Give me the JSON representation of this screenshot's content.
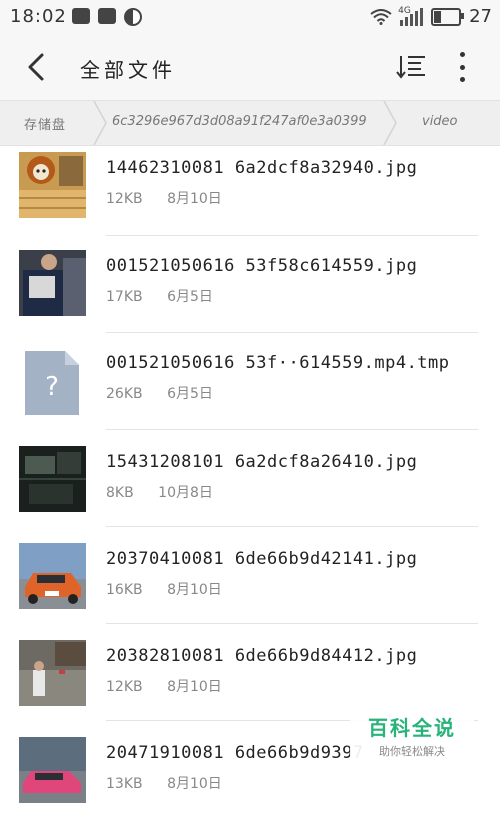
{
  "status_bar": {
    "time": "18:02",
    "network_label": "4G",
    "battery_text": "27",
    "battery_level": 0.27,
    "icons": [
      "image-icon",
      "chat-bubble-icon",
      "half-circle-icon",
      "wifi-icon",
      "signal-icon",
      "battery-icon"
    ]
  },
  "header": {
    "title": "全部文件"
  },
  "breadcrumb": {
    "items": [
      "存储盘",
      "6c3296e967d3d08a91f247af0e3a0399",
      "video"
    ]
  },
  "files": [
    {
      "name": "14462310081 6a2dcf8a32940.jpg",
      "size": "12KB",
      "date": "8月10日",
      "thumb": "cat-plush"
    },
    {
      "name": "001521050616 53f58c614559.jpg",
      "size": "17KB",
      "date": "6月5日",
      "thumb": "person-box"
    },
    {
      "name": "001521050616 53f··614559.mp4.tmp",
      "size": "26KB",
      "date": "6月5日",
      "thumb": "unknown-file"
    },
    {
      "name": "15431208101 6a2dcf8a26410.jpg",
      "size": "8KB",
      "date": "10月8日",
      "thumb": "dark-room"
    },
    {
      "name": "20370410081 6de66b9d42141.jpg",
      "size": "16KB",
      "date": "8月10日",
      "thumb": "orange-car"
    },
    {
      "name": "20382810081 6de66b9d84412.jpg",
      "size": "12KB",
      "date": "8月10日",
      "thumb": "game-scene"
    },
    {
      "name": "20471910081 6de66b9d9397",
      "size": "13KB",
      "date": "8月10日",
      "thumb": "pink-car"
    }
  ],
  "watermark": {
    "main": "百科全说",
    "sub": "助你轻松解决"
  },
  "colors": {
    "background": "#ffffff",
    "topbar": "#f7f7f7",
    "breadcrumb_bg": "#efefef",
    "watermark_green": "#27b37a"
  }
}
